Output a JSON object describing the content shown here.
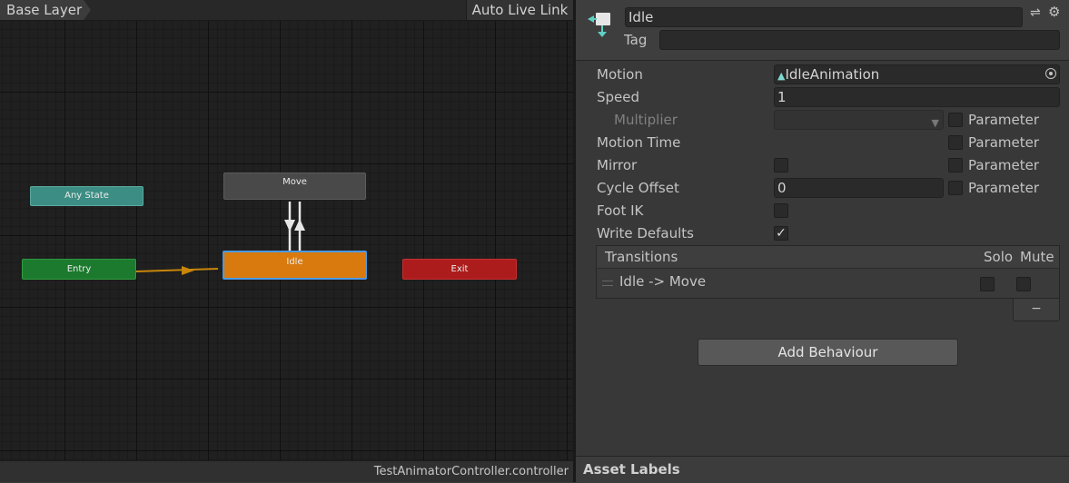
{
  "graph": {
    "breadcrumb": "Base Layer",
    "live_link": "Auto Live Link",
    "file_name": "TestAnimatorController.controller",
    "states": {
      "any_state": "Any State",
      "entry": "Entry",
      "move": "Move",
      "idle": "Idle",
      "exit": "Exit"
    },
    "colors": {
      "any_state": "#3c8d83",
      "entry": "#1c7a2e",
      "move": "#494949",
      "idle": "#d87a0e",
      "exit": "#ac1c1c",
      "selection": "#4a9ae8",
      "entry_transition": "#c8860c"
    }
  },
  "inspector": {
    "name": "Idle",
    "tag_label": "Tag",
    "tag_value": "",
    "icons": {
      "state": "animator-state-icon",
      "preset": "preset-icon",
      "settings": "gear-icon"
    },
    "labels": {
      "motion": "Motion",
      "speed": "Speed",
      "multiplier": "Multiplier",
      "motion_time": "Motion Time",
      "mirror": "Mirror",
      "cycle_offset": "Cycle Offset",
      "foot_ik": "Foot IK",
      "write_defaults": "Write Defaults",
      "parameter": "Parameter"
    },
    "values": {
      "motion": "IdleAnimation",
      "speed": "1",
      "multiplier": "",
      "cycle_offset": "0",
      "mirror": false,
      "foot_ik": false,
      "write_defaults": true,
      "multiplier_parameter": false,
      "motion_time_parameter": false,
      "mirror_parameter": false,
      "cycle_offset_parameter": false
    },
    "transitions": {
      "title": "Transitions",
      "solo": "Solo",
      "mute": "Mute",
      "items": [
        {
          "label": "Idle -> Move",
          "solo": false,
          "mute": false
        }
      ],
      "remove_label": "−"
    },
    "add_behaviour": "Add Behaviour",
    "asset_labels": "Asset Labels"
  }
}
